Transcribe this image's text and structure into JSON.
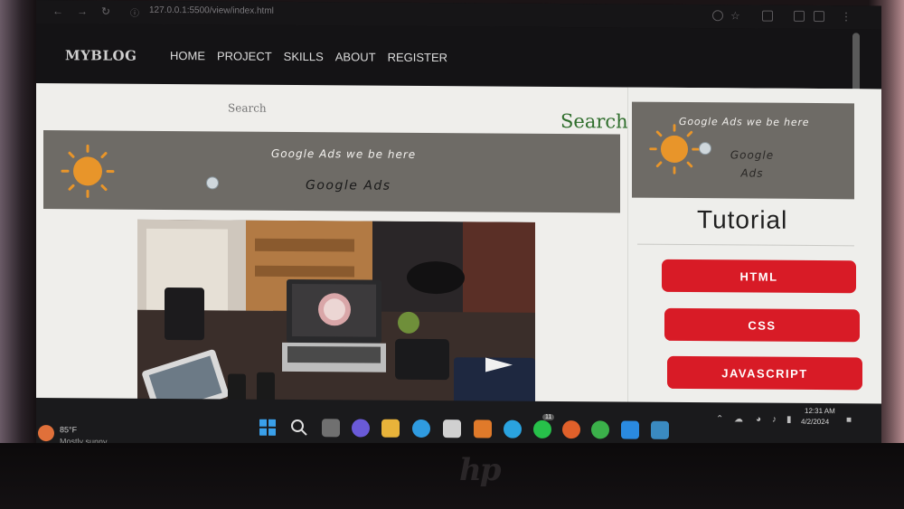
{
  "browser": {
    "url": "127.0.0.1:5500/view/index.html",
    "back_icon": "arrow-left-icon",
    "forward_icon": "arrow-right-icon",
    "reload_icon": "reload-icon"
  },
  "site": {
    "brand": "MYBLOG",
    "nav": [
      "HOME",
      "PROJECT",
      "SKILLS",
      "ABOUT",
      "REGISTER"
    ]
  },
  "search": {
    "placeholder": "Search",
    "label": "Search"
  },
  "main_ad": {
    "title": "Google Ads we be here",
    "subtitle": "Google Ads",
    "icon": "sun-icon"
  },
  "side_ad": {
    "title": "Google Ads we be here",
    "subtitle": "Google Ads",
    "icon": "sun-icon"
  },
  "sidebar": {
    "heading": "Tutorial",
    "buttons": [
      "HTML",
      "CSS",
      "JAVASCRIPT"
    ]
  },
  "colors": {
    "accent_red": "#d81b26",
    "ad_gray": "#6e6b66",
    "search_green": "#2f6e2c",
    "sun_orange": "#e8952a"
  },
  "taskbar": {
    "weather_temp": "85°F",
    "weather_desc": "Mostly sunny",
    "time": "12:31 AM",
    "date": "4/2/2024",
    "whatsapp_badge": "11"
  }
}
